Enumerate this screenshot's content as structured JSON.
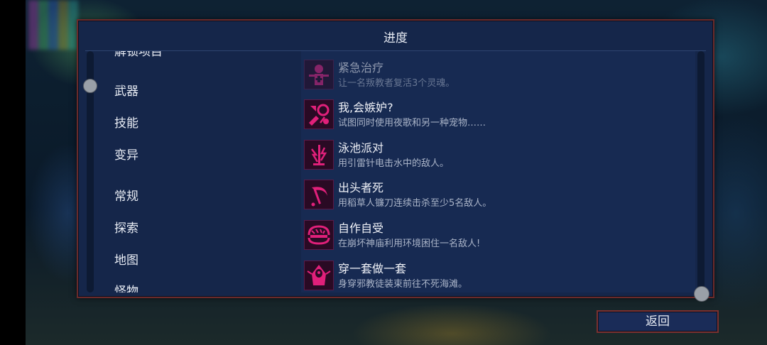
{
  "dialog": {
    "title": "进度"
  },
  "categories": {
    "partial_top": "解锁项目",
    "items": [
      {
        "label": "武器"
      },
      {
        "label": "技能"
      },
      {
        "label": "变异"
      },
      {
        "label": "常规"
      },
      {
        "label": "探索"
      },
      {
        "label": "地图"
      },
      {
        "label": "怪物"
      }
    ]
  },
  "achievements": [
    {
      "title": "紧急治疗",
      "description": "让一名叛教者复活3个灵魂。",
      "icon": "nurse-icon",
      "faded": true
    },
    {
      "title": "我,会嫉妒?",
      "description": "试图同时使用夜歌和另一种宠物……",
      "icon": "pets-icon",
      "faded": false
    },
    {
      "title": "泳池派对",
      "description": "用引雷针电击水中的敌人。",
      "icon": "lightning-rod-icon",
      "faded": false
    },
    {
      "title": "出头者死",
      "description": "用稻草人镰刀连续击杀至少5名敌人。",
      "icon": "scythe-icon",
      "faded": false
    },
    {
      "title": "自作自受",
      "description": "在崩坏神庙利用环境困住一名敌人!",
      "icon": "trap-icon",
      "faded": false
    },
    {
      "title": "穿一套做一套",
      "description": "身穿邪教徒装束前往不死海滩。",
      "icon": "cultist-icon",
      "faded": false
    }
  ],
  "footer": {
    "back_label": "返回"
  },
  "colors": {
    "accent_border": "#7a3030",
    "icon_magenta": "#e0207a"
  }
}
